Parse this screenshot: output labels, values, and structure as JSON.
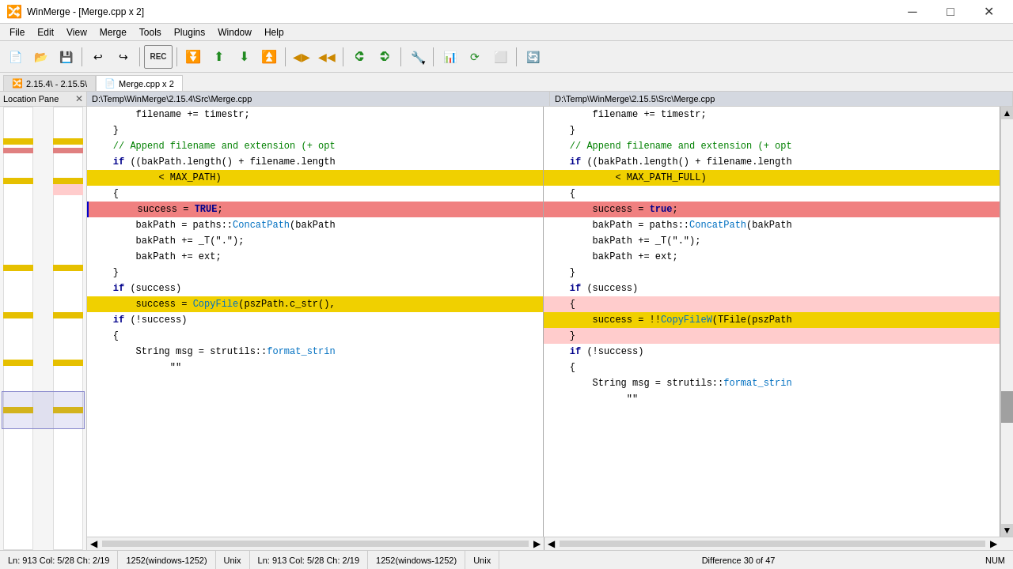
{
  "window": {
    "title": "WinMerge - [Merge.cpp x 2]",
    "icon": "winmerge-icon"
  },
  "title_controls": {
    "minimize": "─",
    "maximize": "□",
    "close": "✕"
  },
  "menu": {
    "items": [
      "File",
      "Edit",
      "View",
      "Merge",
      "Tools",
      "Plugins",
      "Window",
      "Help"
    ]
  },
  "tabs": [
    {
      "label": "2.15.4\\ - 2.15.5\\",
      "icon": "winmerge-small"
    },
    {
      "label": "Merge.cpp x 2",
      "icon": "merge-icon",
      "active": true
    }
  ],
  "location_pane": {
    "label": "Location Pane",
    "close": "✕"
  },
  "panels": {
    "left_path": "D:\\Temp\\WinMerge\\2.15.4\\Src\\Merge.cpp",
    "right_path": "D:\\Temp\\WinMerge\\2.15.5\\Src\\Merge.cpp"
  },
  "code_left": [
    {
      "text": "        filename += timestr;",
      "type": "normal"
    },
    {
      "text": "    }",
      "type": "normal"
    },
    {
      "text": "",
      "type": "normal"
    },
    {
      "text": "    // Append filename and extension (+ opt",
      "type": "normal"
    },
    {
      "text": "    if ((bakPath.length() + filename.length",
      "type": "normal"
    },
    {
      "text": "            < MAX_PATH)",
      "type": "yellow"
    },
    {
      "text": "    {",
      "type": "normal"
    },
    {
      "text": "        success = TRUE;",
      "type": "red",
      "cursor": true
    },
    {
      "text": "        bakPath = paths::ConcatPath(bakPath",
      "type": "normal"
    },
    {
      "text": "        bakPath += _T(\".\");",
      "type": "normal"
    },
    {
      "text": "        bakPath += ext;",
      "type": "normal"
    },
    {
      "text": "    }",
      "type": "normal"
    },
    {
      "text": "",
      "type": "normal"
    },
    {
      "text": "    if (success)",
      "type": "normal"
    },
    {
      "text": "        success = CopyFile(pszPath.c_str(),",
      "type": "yellow"
    },
    {
      "text": "",
      "type": "gray"
    },
    {
      "text": "",
      "type": "gray"
    },
    {
      "text": "",
      "type": "normal"
    },
    {
      "text": "    if (!success)",
      "type": "normal"
    },
    {
      "text": "    {",
      "type": "normal"
    },
    {
      "text": "        String msg = strutils::format_strin",
      "type": "normal"
    },
    {
      "text": "              \"\"",
      "type": "normal"
    }
  ],
  "code_right": [
    {
      "text": "        filename += timestr;",
      "type": "normal"
    },
    {
      "text": "    }",
      "type": "normal"
    },
    {
      "text": "",
      "type": "normal"
    },
    {
      "text": "    // Append filename and extension (+ opt",
      "type": "normal"
    },
    {
      "text": "    if ((bakPath.length() + filename.length",
      "type": "normal"
    },
    {
      "text": "            < MAX_PATH_FULL)",
      "type": "yellow"
    },
    {
      "text": "    {",
      "type": "normal"
    },
    {
      "text": "        success = true;",
      "type": "red"
    },
    {
      "text": "        bakPath = paths::ConcatPath(bakPath",
      "type": "normal"
    },
    {
      "text": "        bakPath += _T(\".\");",
      "type": "normal"
    },
    {
      "text": "        bakPath += ext;",
      "type": "normal"
    },
    {
      "text": "    }",
      "type": "normal"
    },
    {
      "text": "",
      "type": "normal"
    },
    {
      "text": "    if (success)",
      "type": "normal"
    },
    {
      "text": "    {",
      "type": "pink"
    },
    {
      "text": "        success = !!CopyFileW(TFile(pszPath",
      "type": "yellow"
    },
    {
      "text": "    }",
      "type": "pink"
    },
    {
      "text": "",
      "type": "normal"
    },
    {
      "text": "    if (!success)",
      "type": "normal"
    },
    {
      "text": "    {",
      "type": "normal"
    },
    {
      "text": "        String msg = strutils::format_strin",
      "type": "normal"
    },
    {
      "text": "              \"\"",
      "type": "normal"
    }
  ],
  "status_left": {
    "position": "Ln: 913  Col: 5/28  Ch: 2/19",
    "encoding": "1252(windows-1252)",
    "eol": "Unix"
  },
  "status_right": {
    "position": "Ln: 913  Col: 5/28  Ch: 2/19",
    "encoding": "1252(windows-1252)",
    "eol": "Unix"
  },
  "status_diff": "Difference 30 of 47",
  "status_num": "NUM"
}
